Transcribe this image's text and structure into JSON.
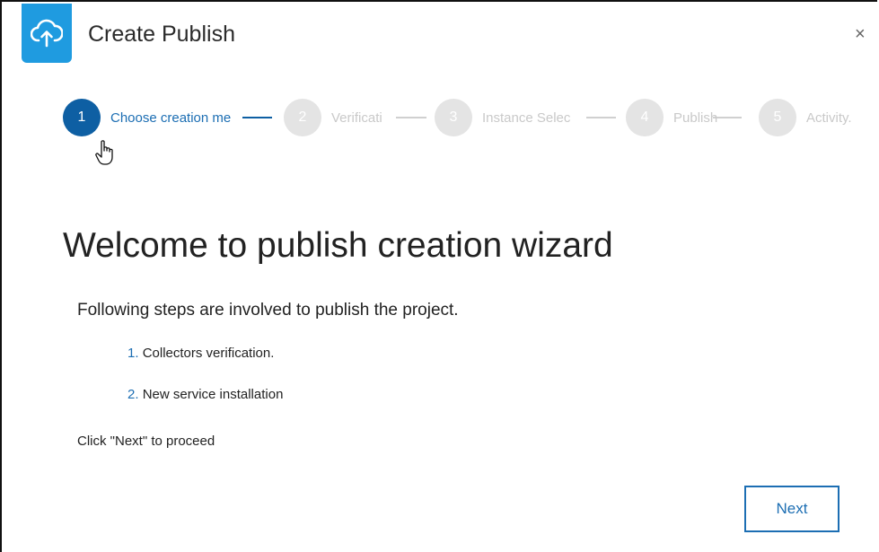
{
  "dialog": {
    "title": "Create Publish",
    "icon": "cloud-upload-icon",
    "close_label": "×",
    "accent_color": "#1f9be0",
    "active_color": "#0e5fa3"
  },
  "stepper": {
    "active_step": 1,
    "steps": [
      {
        "number": "1",
        "label": "Choose creation me",
        "state": "active"
      },
      {
        "number": "2",
        "label": "Verificati",
        "state": "inactive"
      },
      {
        "number": "3",
        "label": "Instance Selec",
        "state": "inactive"
      },
      {
        "number": "4",
        "label": "Publish",
        "state": "inactive"
      },
      {
        "number": "5",
        "label": "Activity.",
        "state": "inactive"
      }
    ]
  },
  "content": {
    "heading": "Welcome to publish creation wizard",
    "intro": "Following steps are involved to publish the project.",
    "items": [
      {
        "number": "1.",
        "text": "Collectors verification."
      },
      {
        "number": "2.",
        "text": "New service installation"
      }
    ],
    "proceed": "Click \"Next\" to proceed"
  },
  "footer": {
    "next_label": "Next"
  }
}
